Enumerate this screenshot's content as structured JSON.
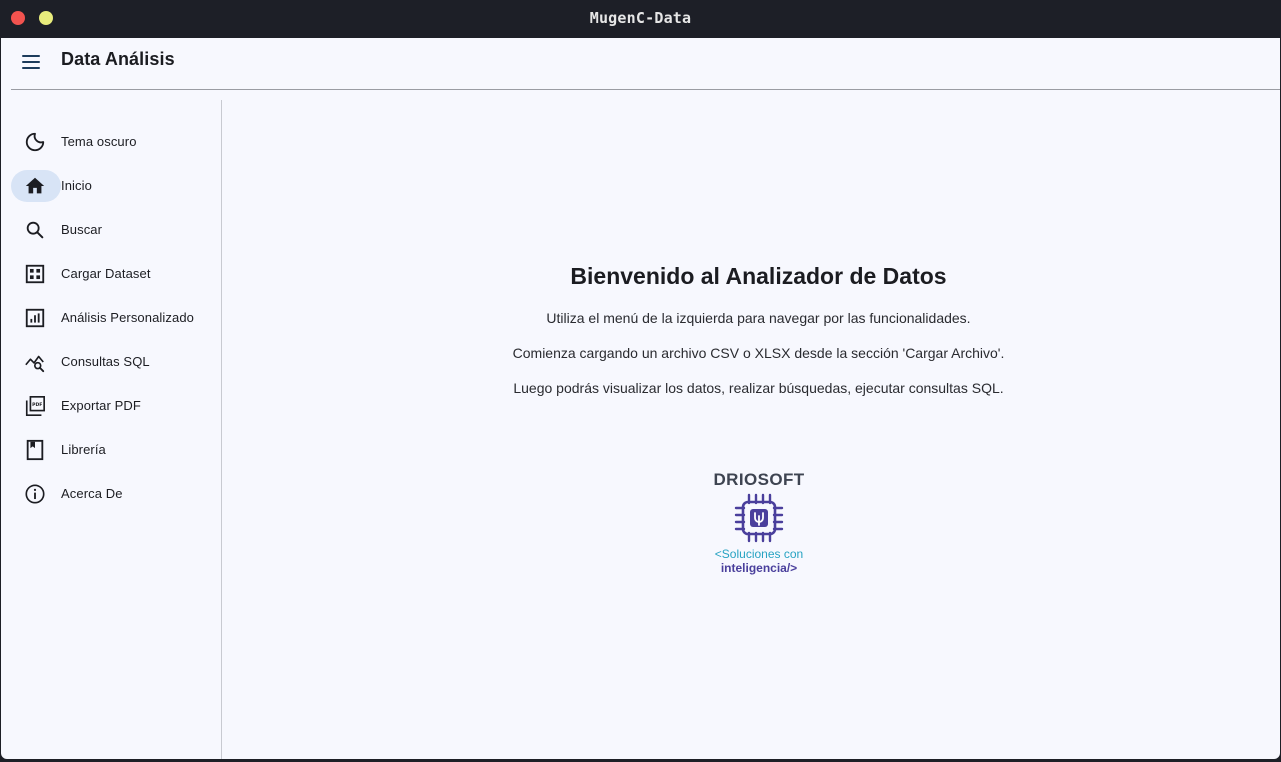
{
  "window": {
    "title": "MugenC-Data"
  },
  "appbar": {
    "title": "Data Análisis"
  },
  "sidebar": {
    "items": [
      {
        "label": "Tema oscuro",
        "icon": "moon-icon",
        "active": false
      },
      {
        "label": "Inicio",
        "icon": "home-icon",
        "active": true
      },
      {
        "label": "Buscar",
        "icon": "search-icon",
        "active": false
      },
      {
        "label": "Cargar Dataset",
        "icon": "grid-icon",
        "active": false
      },
      {
        "label": "Análisis Personalizado",
        "icon": "bar-chart-icon",
        "active": false
      },
      {
        "label": "Consultas SQL",
        "icon": "query-stats-icon",
        "active": false
      },
      {
        "label": "Exportar PDF",
        "icon": "pdf-icon",
        "active": false
      },
      {
        "label": "Librería",
        "icon": "book-icon",
        "active": false
      },
      {
        "label": "Acerca De",
        "icon": "info-icon",
        "active": false
      }
    ]
  },
  "main": {
    "title": "Bienvenido al Analizador de Datos",
    "lines": [
      "Utiliza el menú de la izquierda para navegar por las funcionalidades.",
      "Comienza cargando un archivo CSV o XLSX desde la sección 'Cargar Archivo'.",
      "Luego podrás visualizar los datos, realizar búsquedas, ejecutar consultas SQL."
    ],
    "logo": {
      "brand": "DRIOSOFT",
      "tagline_1": "<Soluciones con",
      "tagline_2": "inteligencia/>"
    }
  },
  "colors": {
    "background": "#f7f8fe",
    "titlebar": "#1d1f27",
    "active_pill": "#d8e4f6",
    "logo_purple": "#4a3f9c",
    "logo_cyan": "#27a3c2"
  }
}
